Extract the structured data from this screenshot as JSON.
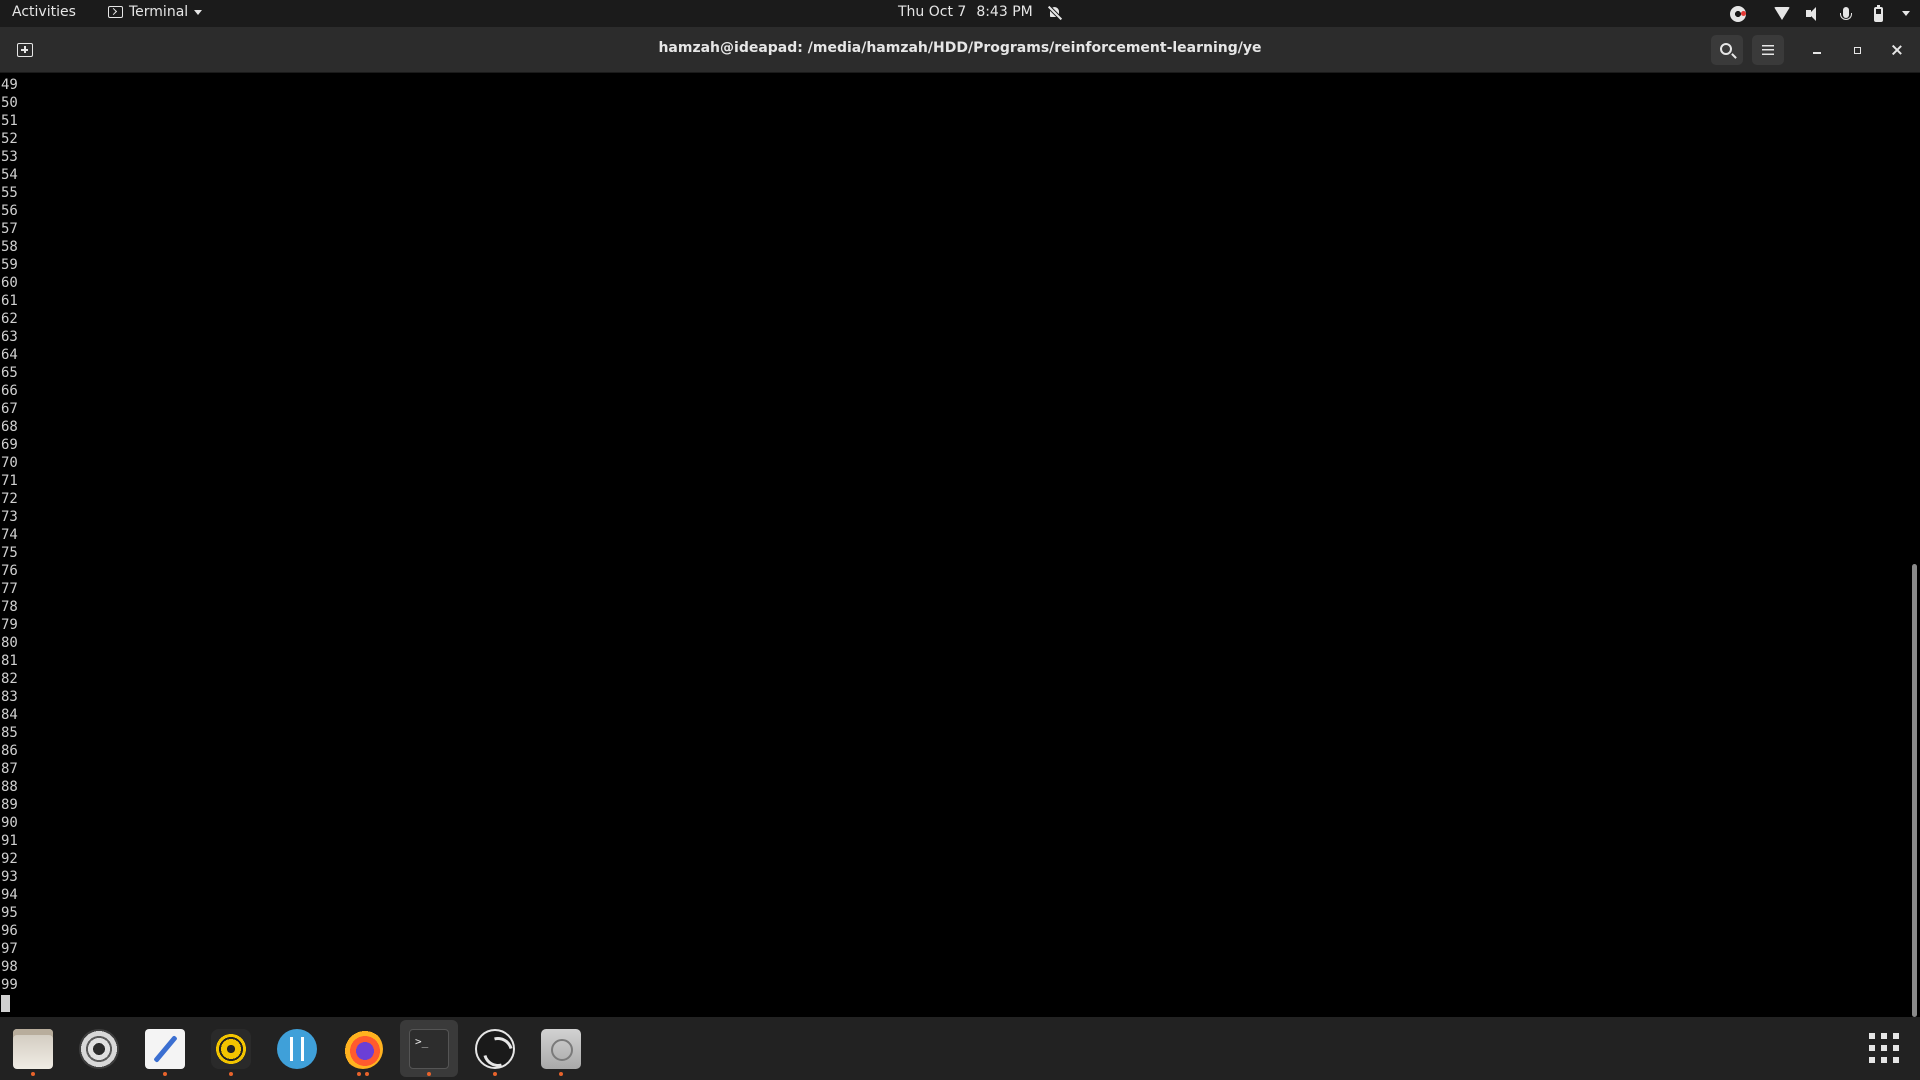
{
  "topbar": {
    "activities": "Activities",
    "app_menu": {
      "label": "Terminal"
    },
    "date": "Thu Oct 7",
    "time": "8:43 PM",
    "icons": [
      "notifications-off-icon",
      "obs-tray-icon",
      "wifi-icon",
      "volume-icon",
      "microphone-icon",
      "battery-icon",
      "system-menu-chevron-icon"
    ]
  },
  "terminal": {
    "title": "hamzah@ideapad: /media/hamzah/HDD/Programs/reinforcement-learning/ye",
    "output_lines": [
      "49",
      "50",
      "51",
      "52",
      "53",
      "54",
      "55",
      "56",
      "57",
      "58",
      "59",
      "60",
      "61",
      "62",
      "63",
      "64",
      "65",
      "66",
      "67",
      "68",
      "69",
      "70",
      "71",
      "72",
      "73",
      "74",
      "75",
      "76",
      "77",
      "78",
      "79",
      "80",
      "81",
      "82",
      "83",
      "84",
      "85",
      "86",
      "87",
      "88",
      "89",
      "90",
      "91",
      "92",
      "93",
      "94",
      "95",
      "96",
      "97",
      "98",
      "99"
    ],
    "scroll_position": 0.52,
    "scroll_visible_fraction": 0.48,
    "colors": {
      "background": "#000000",
      "text": "#d0d0d0",
      "header": "#2c2c2c"
    }
  },
  "dock": {
    "apps": [
      {
        "name": "files-icon",
        "running": true
      },
      {
        "name": "settings-icon",
        "running": false
      },
      {
        "name": "text-editor-icon",
        "running": true
      },
      {
        "name": "rhythmbox-icon",
        "running": true
      },
      {
        "name": "tuner-icon",
        "running": false
      },
      {
        "name": "firefox-icon",
        "running": true,
        "dots": 2
      },
      {
        "name": "terminal-icon",
        "running": true,
        "active": true,
        "glyph": ">_"
      },
      {
        "name": "obs-icon",
        "running": true
      },
      {
        "name": "disks-icon",
        "running": true
      }
    ],
    "accent": "#e8632b"
  }
}
